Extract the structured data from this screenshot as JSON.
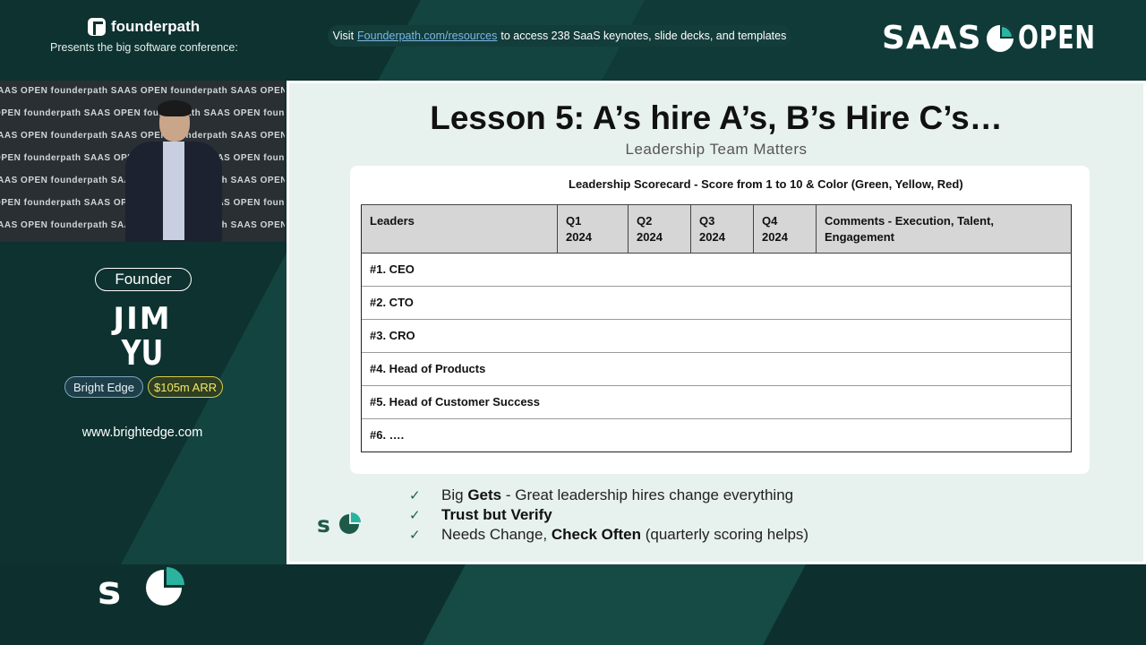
{
  "header": {
    "brand": "founderpath",
    "presents": "Presents the big software conference:",
    "visit_prefix": "Visit",
    "visit_link": "Founderpath.com/resources",
    "visit_suffix": "to access 238 SaaS keynotes, slide decks, and templates",
    "event_logo_left": "SAAS",
    "event_logo_right": "OPEN"
  },
  "video": {
    "backdrop_text": "SAAS OPEN   founderpath   SAAS OPEN   founderpath   SAAS OPEN   founderpath"
  },
  "speaker": {
    "role": "Founder",
    "first_name": "JIM",
    "last_name": "YU",
    "company": "Bright Edge",
    "arr": "$105m ARR",
    "website": "www.brightedge.com"
  },
  "slide": {
    "title": "Lesson 5: A’s hire A’s, B’s Hire C’s…",
    "subtitle": "Leadership Team Matters",
    "table_title": "Leadership Scorecard - Score from 1 to 10 & Color (Green, Yellow, Red)",
    "columns": {
      "leaders": "Leaders",
      "q1a": "Q1",
      "q1b": "2024",
      "q2a": "Q2",
      "q2b": "2024",
      "q3a": "Q3",
      "q3b": "2024",
      "q4a": "Q4",
      "q4b": "2024",
      "comments": "Comments - Execution, Talent, Engagement"
    },
    "rows": [
      "#1.  CEO",
      "#2.  CTO",
      "#3.  CRO",
      "#4.  Head of Products",
      "#5.  Head of Customer Success",
      "#6.  …."
    ],
    "bullets": {
      "b1_pre": "Big ",
      "b1_bold": "Gets",
      "b1_post": " - Great leadership hires change everything",
      "b2_bold": "Trust but Verify",
      "b3_pre": "Needs Change, ",
      "b3_bold": "Check Often",
      "b3_post": " (quarterly scoring helps)"
    }
  },
  "colors": {
    "background": "#0d3230",
    "slide_bg": "#e7f1ee",
    "accent": "#2bb3a0",
    "check": "#1f5f4e"
  }
}
